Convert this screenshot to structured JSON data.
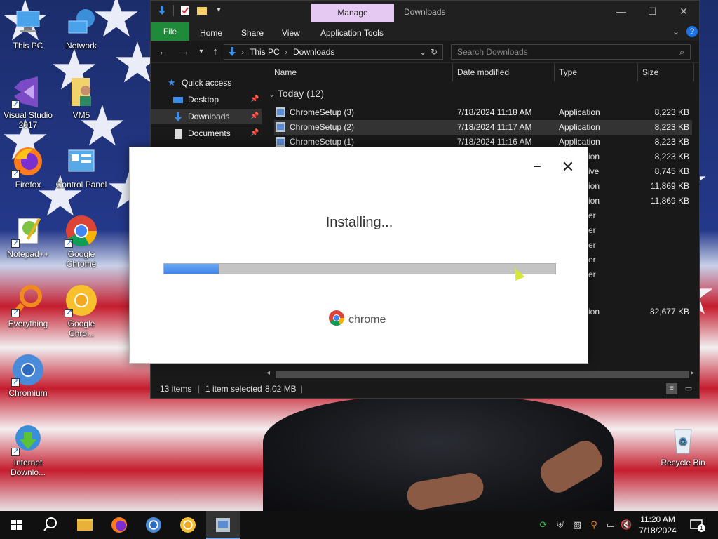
{
  "desktop": {
    "icons": [
      {
        "label": "This PC",
        "icon": "computer-icon"
      },
      {
        "label": "Network",
        "icon": "network-icon"
      },
      {
        "label": "Visual Studio 2017",
        "icon": "visual-studio-icon"
      },
      {
        "label": "VM5",
        "icon": "user-folder-icon"
      },
      {
        "label": "Firefox",
        "icon": "firefox-icon"
      },
      {
        "label": "Control Panel",
        "icon": "control-panel-icon"
      },
      {
        "label": "Notepad++",
        "icon": "notepad-plus-plus-icon"
      },
      {
        "label": "Google Chrome",
        "icon": "chrome-icon"
      },
      {
        "label": "Everything",
        "icon": "everything-search-icon"
      },
      {
        "label": "Google Chro...",
        "icon": "chrome-canary-icon"
      },
      {
        "label": "Chromium",
        "icon": "chromium-icon"
      },
      {
        "label": "Internet Downlo...",
        "icon": "internet-download-manager-icon"
      },
      {
        "label": "Recycle Bin",
        "icon": "recycle-bin-icon"
      }
    ]
  },
  "explorer": {
    "title": "Downloads",
    "manage_tab": "Manage",
    "ribbon": {
      "file": "File",
      "home": "Home",
      "share": "Share",
      "view": "View",
      "app_tools": "Application Tools"
    },
    "address": {
      "this_pc": "This PC",
      "downloads": "Downloads"
    },
    "search_placeholder": "Search Downloads",
    "nav": [
      {
        "label": "Quick access",
        "icon": "star-icon"
      },
      {
        "label": "Desktop",
        "icon": "desktop-icon"
      },
      {
        "label": "Downloads",
        "icon": "download-icon"
      },
      {
        "label": "Documents",
        "icon": "documents-icon"
      }
    ],
    "columns": {
      "name": "Name",
      "date": "Date modified",
      "type": "Type",
      "size": "Size"
    },
    "group": "Today (12)",
    "rows": [
      {
        "name": "ChromeSetup (3)",
        "date": "7/18/2024 11:18 AM",
        "type": "Application",
        "size": "8,223 KB"
      },
      {
        "name": "ChromeSetup (2)",
        "date": "7/18/2024 11:17 AM",
        "type": "Application",
        "size": "8,223 KB"
      },
      {
        "name": "ChromeSetup (1)",
        "date": "7/18/2024 11:16 AM",
        "type": "Application",
        "size": "8,223 KB"
      }
    ],
    "hidden_rows": [
      {
        "type": "ion",
        "size": "8,223 KB"
      },
      {
        "type": "ive",
        "size": "8,745 KB"
      },
      {
        "type": "ion",
        "size": "11,869 KB"
      },
      {
        "type": "ion",
        "size": "11,869 KB"
      },
      {
        "type": "er",
        "size": ""
      },
      {
        "type": "er",
        "size": ""
      },
      {
        "type": "er",
        "size": ""
      },
      {
        "type": "er",
        "size": ""
      },
      {
        "type": "er",
        "size": ""
      },
      {
        "type": "ion",
        "size": "82,677 KB"
      }
    ],
    "status": {
      "items": "13 items",
      "selected": "1 item selected",
      "size": "8.02 MB"
    }
  },
  "installer": {
    "message": "Installing...",
    "progress": 0.14,
    "brand": "chrome",
    "colors": {
      "progress_fill": "#3f87ea",
      "progress_track": "#c4c4c4"
    }
  },
  "taskbar": {
    "apps": [
      "start-icon",
      "search-icon",
      "file-explorer-icon",
      "firefox-icon",
      "chromium-icon",
      "chrome-canary-icon",
      "installer-icon"
    ],
    "clock": {
      "time": "11:20 AM",
      "date": "7/18/2024"
    },
    "notification_count": "1"
  }
}
